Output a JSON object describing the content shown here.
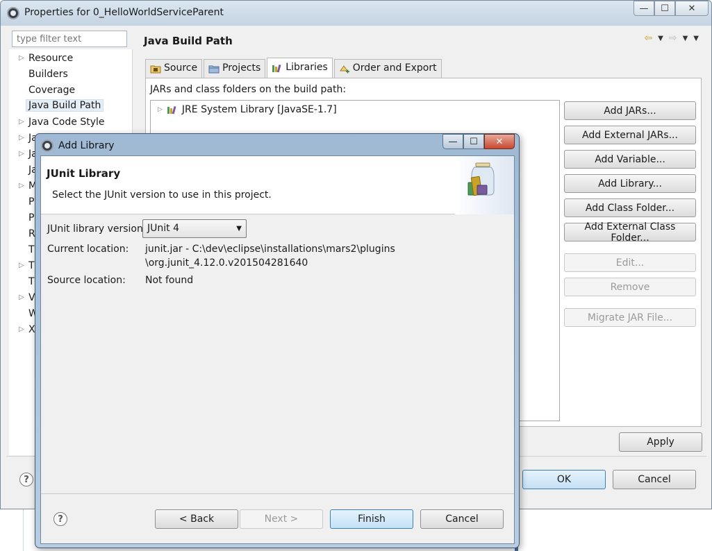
{
  "window": {
    "title": "Properties for 0_HelloWorldServiceParent",
    "minimize": "—",
    "maximize": "☐",
    "close": "✕"
  },
  "filter": {
    "placeholder": "type filter text"
  },
  "tree": {
    "items": [
      {
        "label": "Resource",
        "arrow": "▷"
      },
      {
        "label": "Builders"
      },
      {
        "label": "Coverage"
      },
      {
        "label": "Java Build Path",
        "selected": true
      },
      {
        "label": "Java Code Style",
        "arrow": "▷"
      },
      {
        "label": "Ja",
        "arrow": "▷"
      },
      {
        "label": "Ja",
        "arrow": "▷"
      },
      {
        "label": "Ja"
      },
      {
        "label": "M",
        "arrow": "▷"
      },
      {
        "label": "P"
      },
      {
        "label": "P"
      },
      {
        "label": "R"
      },
      {
        "label": "T"
      },
      {
        "label": "T",
        "arrow": "▷"
      },
      {
        "label": "T"
      },
      {
        "label": "V",
        "arrow": "▷"
      },
      {
        "label": "W"
      },
      {
        "label": "X",
        "arrow": "▷"
      }
    ]
  },
  "page": {
    "title": "Java Build Path",
    "nav_back": "⇦",
    "nav_forward": "⇨",
    "dropdown": "▼",
    "tabs": [
      {
        "label": "Source"
      },
      {
        "label": "Projects"
      },
      {
        "label": "Libraries",
        "active": true
      },
      {
        "label": "Order and Export"
      }
    ],
    "section_label": "JARs and class folders on the build path:",
    "libraries": [
      {
        "label": "JRE System Library [JavaSE-1.7]",
        "arrow": "▷"
      }
    ],
    "buttons": {
      "add_jars": "Add JARs...",
      "add_external_jars": "Add External JARs...",
      "add_variable": "Add Variable...",
      "add_library": "Add Library...",
      "add_class_folder": "Add Class Folder...",
      "add_external_class_folder": "Add External Class Folder...",
      "edit": "Edit...",
      "remove": "Remove",
      "migrate": "Migrate JAR File..."
    },
    "apply": "Apply",
    "ok": "OK",
    "cancel": "Cancel",
    "help": "?"
  },
  "dialog": {
    "title": "Add Library",
    "minimize": "—",
    "maximize": "☐",
    "close": "✕",
    "header_title": "JUnit Library",
    "header_message": "Select the JUnit version to use in this project.",
    "version_label": "JUnit library version:",
    "version_value": "JUnit 4",
    "combo_arrow": "▼",
    "current_location_label": "Current location:",
    "current_location_line1": "junit.jar - C:\\dev\\eclipse\\installations\\mars2\\plugins",
    "current_location_line2": "\\org.junit_4.12.0.v201504281640",
    "source_location_label": "Source location:",
    "source_location_value": "Not found",
    "buttons": {
      "back": "< Back",
      "next": "Next >",
      "finish": "Finish",
      "cancel": "Cancel",
      "help": "?"
    }
  }
}
